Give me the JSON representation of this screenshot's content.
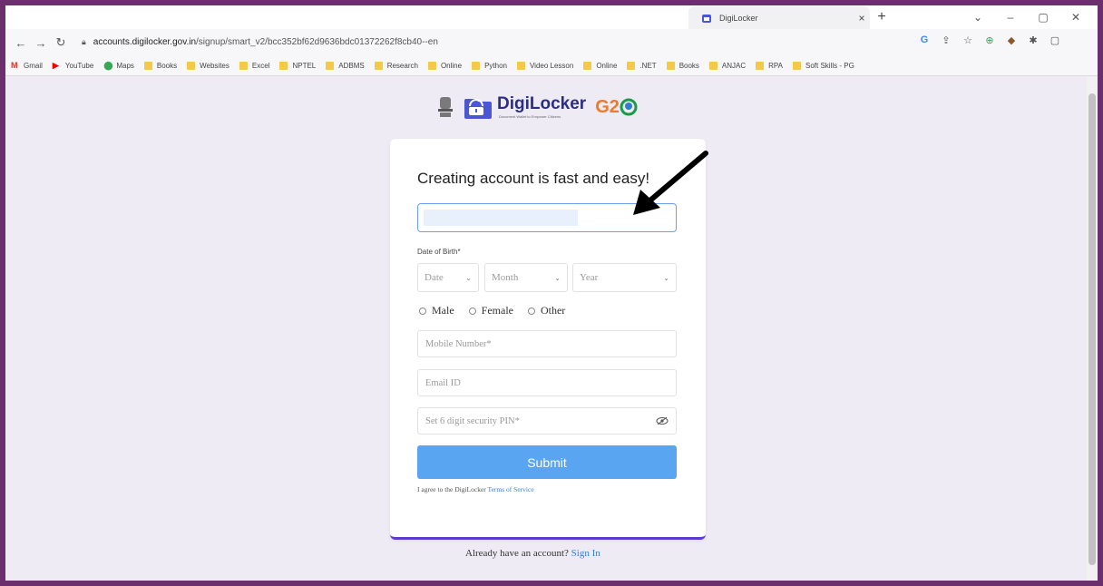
{
  "browser": {
    "tab_title": "DigiLocker",
    "tab_close": "×",
    "new_tab": "+",
    "window_buttons": [
      "⌄",
      "–",
      "▢",
      "✕"
    ],
    "url_domain": "accounts.digilocker.gov.in",
    "url_path": "/signup/smart_v2/bcc352bf62d9636bdc01372262f8cb40--en",
    "bookmarks": [
      {
        "label": "Gmail",
        "icon": "gmail-icon"
      },
      {
        "label": "YouTube",
        "icon": "youtube-icon"
      },
      {
        "label": "Maps",
        "icon": "maps-icon"
      },
      {
        "label": "Books",
        "icon": "folder-icon"
      },
      {
        "label": "Websites",
        "icon": "folder-icon"
      },
      {
        "label": "Excel",
        "icon": "folder-icon"
      },
      {
        "label": "NPTEL",
        "icon": "folder-icon"
      },
      {
        "label": "ADBMS",
        "icon": "folder-icon"
      },
      {
        "label": "Research",
        "icon": "folder-icon"
      },
      {
        "label": "Online",
        "icon": "folder-icon"
      },
      {
        "label": "Python",
        "icon": "folder-icon"
      },
      {
        "label": "Video Lesson",
        "icon": "folder-icon"
      },
      {
        "label": "Online",
        "icon": "folder-icon"
      },
      {
        "label": ".NET",
        "icon": "folder-icon"
      },
      {
        "label": "Books",
        "icon": "folder-icon"
      },
      {
        "label": "ANJAC",
        "icon": "folder-icon"
      },
      {
        "label": "RPA",
        "icon": "folder-icon"
      },
      {
        "label": "Soft Skills - PG",
        "icon": "folder-icon"
      }
    ]
  },
  "header": {
    "brand": "DigiLocker",
    "tagline": "Document Wallet to Empower Citizens",
    "g20_g": "G2",
    "g20_zero": "0"
  },
  "form": {
    "title": "Creating account is fast and easy!",
    "dob_label": "Date of Birth*",
    "date_placeholder": "Date",
    "month_placeholder": "Month",
    "year_placeholder": "Year",
    "genders": [
      "Male",
      "Female",
      "Other"
    ],
    "mobile_placeholder": "Mobile Number*",
    "email_placeholder": "Email ID",
    "pin_placeholder": "Set 6 digit security PIN*",
    "submit_label": "Submit",
    "terms_prefix": "I agree to the DigiLocker ",
    "terms_link": "Terms of Service"
  },
  "footer": {
    "signin_prefix": "Already have an account? ",
    "signin_link": "Sign In"
  },
  "colors": {
    "frame": "#6b2f6e",
    "page_bg": "#eeebf5",
    "submit_bg": "#5aa5f2",
    "brand_blue": "#2b2e83",
    "card_accent": "#5a3ad1",
    "link": "#3b7fd6"
  }
}
